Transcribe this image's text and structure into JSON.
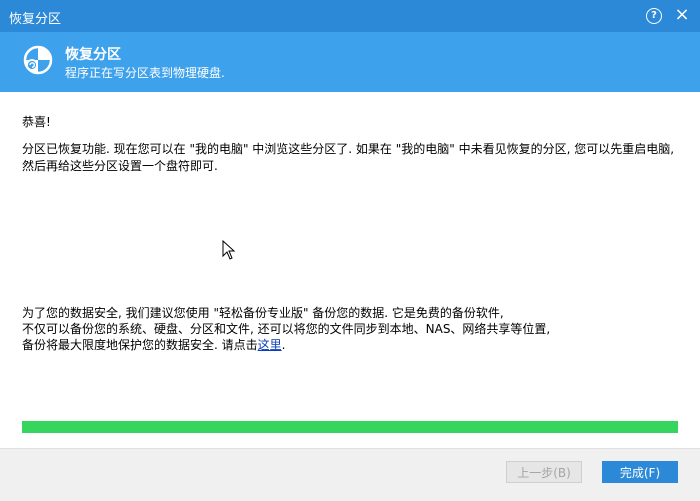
{
  "window": {
    "title": "恢复分区",
    "help_icon": "?",
    "close_icon": "×"
  },
  "header": {
    "title": "恢复分区",
    "subtitle": "程序正在写分区表到物理硬盘."
  },
  "content": {
    "greeting": "恭喜!",
    "message": "分区已恢复功能. 现在您可以在 \"我的电脑\" 中浏览这些分区了. 如果在 \"我的电脑\" 中未看见恢复的分区, 您可以先重启电脑, 然后再给这些分区设置一个盘符即可."
  },
  "promo": {
    "line1": "为了您的数据安全, 我们建议您使用 \"轻松备份专业版\" 备份您的数据. 它是免费的备份软件,",
    "line2": "不仅可以备份您的系统、硬盘、分区和文件, 还可以将您的文件同步到本地、NAS、网络共享等位置,",
    "line3_prefix": "备份将最大限度地保护您的数据安全. 请点击",
    "link_text": "这里",
    "line3_suffix": "."
  },
  "progress": {
    "value": 1.0,
    "color": "#36d65e"
  },
  "footer": {
    "prev_label": "上一步(B)",
    "finish_label": "完成(F)"
  },
  "colors": {
    "titlebar": "#2b89d8",
    "header": "#3ea1ec",
    "primary_button": "#2b89d8"
  }
}
